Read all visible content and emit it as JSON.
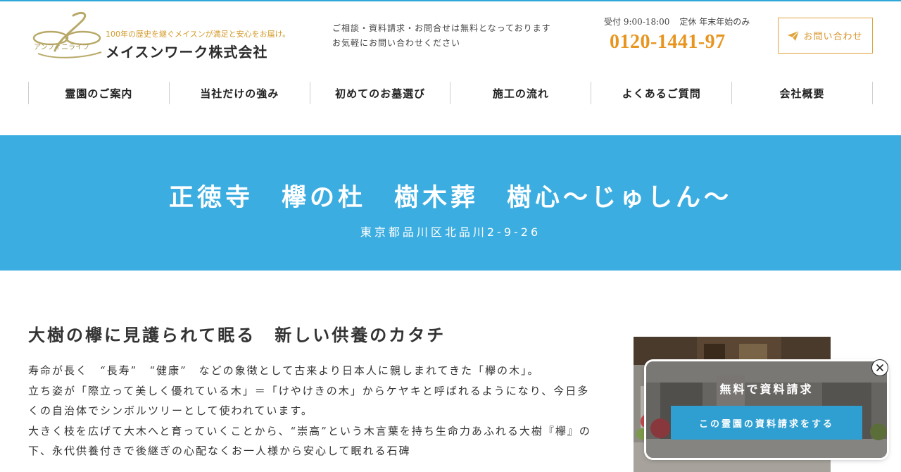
{
  "header": {
    "logo": {
      "script_text": "アンフィニライフ",
      "tagline": "100年の歴史を継ぐメイスンが満足と安心をお届け。",
      "company": "メイスンワーク株式会社"
    },
    "consultation": {
      "line1": "ご相談・資料請求・お問合せは無料となっております",
      "line2": "お気軽にお問い合わせください"
    },
    "hours": {
      "reception": "受付 9:00-18:00",
      "closed": "定休 年末年始のみ"
    },
    "phone": "0120-1441-97",
    "contact_button": {
      "label": "お問い合わせ",
      "icon": "paper-plane-icon"
    }
  },
  "nav": {
    "items": [
      {
        "label": "霊園のご案内"
      },
      {
        "label": "当社だけの強み"
      },
      {
        "label": "初めてのお墓選び"
      },
      {
        "label": "施工の流れ"
      },
      {
        "label": "よくあるご質問"
      },
      {
        "label": "会社概要"
      }
    ]
  },
  "hero": {
    "title": "正徳寺　欅の杜　樹木葬　樹心〜じゅしん〜",
    "address": "東京都品川区北品川2-9-26"
  },
  "content": {
    "heading": "大樹の欅に見護られて眠る　新しい供養のカタチ",
    "paragraphs": [
      "寿命が長く　“長寿”　“健康”　などの象徴として古来より日本人に親しまれてきた「欅の木」。",
      "立ち姿が「際立って美しく優れている木」＝「けやけきの木」からケヤキと呼ばれるようになり、今日多くの自治体でシンボルツリーとして使われています。",
      "大きく枝を広げて大木へと育っていくことから、“崇高”という木言葉を持ち生命力あふれる大樹『欅』の下、永代供養付きで後継ぎの心配なくお一人様から安心して眠れる石碑"
    ]
  },
  "floating_banner": {
    "title": "無料で資料請求",
    "cta": "この霊園の資料請求をする"
  },
  "colors": {
    "accent_blue": "#3cade0",
    "accent_orange": "#e8951f",
    "logo_gold": "#b8a968"
  }
}
